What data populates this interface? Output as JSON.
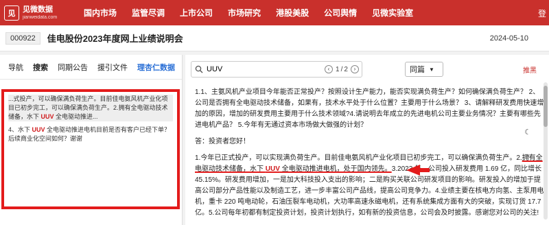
{
  "app": {
    "logo_mark": "见",
    "logo_cn": "见微数据",
    "logo_en": "jianweidata.com",
    "login": "登"
  },
  "nav": [
    "国内市场",
    "监管尽调",
    "上市公司",
    "市场研究",
    "港股美股",
    "公司舆情",
    "见微实验室"
  ],
  "header": {
    "stock_code": "000922",
    "title": "佳电股份2023年度网上业绩说明会",
    "date": "2024-05-10"
  },
  "left_panel": {
    "tabs": [
      "导航",
      "搜索",
      "同期公告",
      "援引文件",
      "理杏仁数据"
    ],
    "results": [
      {
        "pre": "...式投产，可以确保满负荷生产。目前佳电氨风机产业化项目已初步完工，可以确保满负荷生产。2.拥有全电驱动技术储备，水下 ",
        "hl": "UUV",
        "post": " 全电驱动推进..."
      },
      {
        "pre": "4、水下 ",
        "hl": "UUV",
        "post": " 全电驱动推进电机目前是否有客户已经下单？后续商业化空间如何？谢谢"
      }
    ]
  },
  "right_panel": {
    "search_value": "UUV",
    "page_current": "1",
    "page_total": "2",
    "select_label": "同篇",
    "push_label": "推黑",
    "question": "1.1、主氨风机产业项目今年能否正常投产？按照设计生产能力，能否实现满负荷生产？如何确保满负荷生产？ 2、公司是否拥有全电驱动技术储备，如果有，技术水平处于什么位置？主要用于什么场景？ 3、请解释研发费用快速增加的原因，增加的研发费用主要用于什么技术领域?4.请说明去年成立的先进电机公司主要业务情况？主要有哪些先进电机产品？ 5.今年有无通过资本市场做大做强的计划？",
    "answer_greeting": "答：投资者您好！",
    "answer_part1": "1.今年已正式投产，可以实现满负荷生产。目前佳电氨风机产业化项目已初步完工，可以确保满负荷生产。2.",
    "answer_underline_a": "拥有全电驱动技术储备，水下 ",
    "answer_hl": "UUV",
    "answer_underline_b": " 全电驱动推进电机，处于国内领先。",
    "answer_part2": "3.2023 年，公司投入研发费用 1.69 亿，同比增长 45.15%。研发费用增加，一是加大科技投入支出的影响；二是购买关联公司研发项目的影响。研发投入的增加于提高公司部分产品性能以及制造工艺，进一步丰富公司产品线，提高公司竞争力。4.业绩主要在核电方向氢、主泵用电机，重卡 220 吨电动轮，石油压裂车电动机，大功率高速永磁电机，还有系统集成方面有大的突破，实现订货 17.7 亿。5.公司每年初都有制定投资计划，投资计划执行，如有新的投资信息，公司会及时披露。感谢您对公司的关注!"
  },
  "colors": {
    "brand_red": "#c9302c",
    "highlight_red": "#d0191b",
    "tab_blue": "#2a6fd6",
    "annotation_red": "#e31b1b"
  }
}
